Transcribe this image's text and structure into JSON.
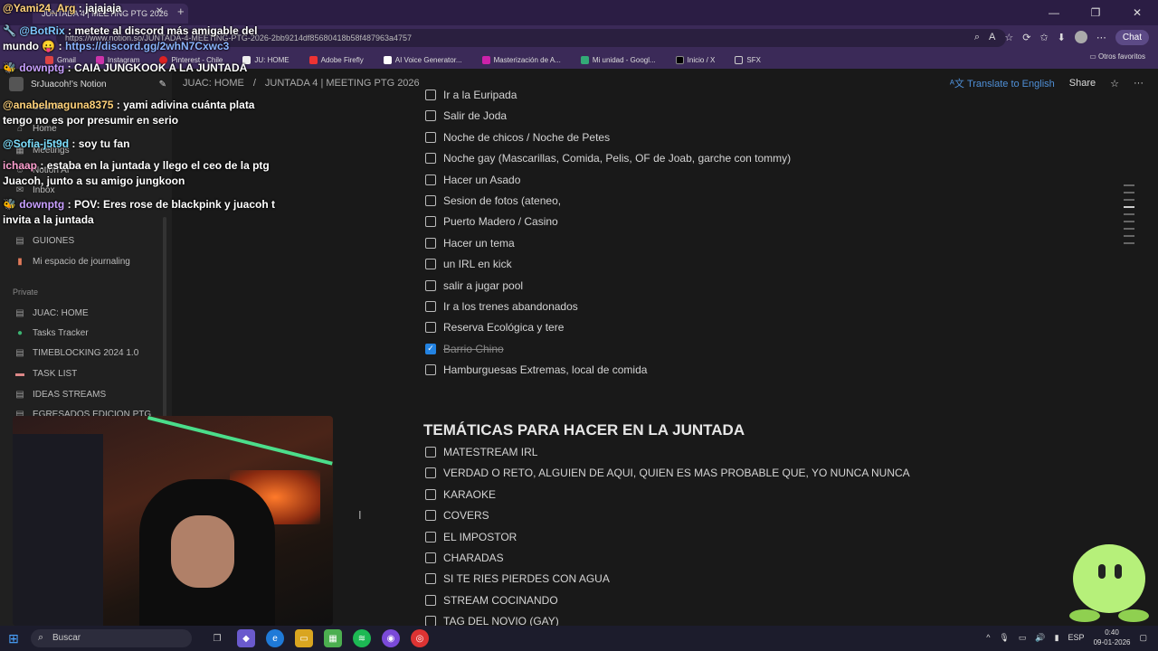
{
  "browser": {
    "tab_title": "JUNTADA 4 | MEETING PTG 2026",
    "url": "https://www.notion.so/JUNTADA-4-MEETING-PTG-2026-2bb9214df85680418b58f487963a4757",
    "chat_label": "Chat",
    "bookmarks": [
      "Gmail",
      "Instagram",
      "Pinterest - Chile",
      "JU: HOME",
      "Adobe Firefly",
      "AI Voice Generator...",
      "Masterización de A...",
      "Mi unidad - Googl...",
      "Inicio / X",
      "SFX"
    ],
    "other_bookmarks": "Otros favoritos"
  },
  "notion": {
    "workspace": "SrJuacoh!'s Notion",
    "breadcrumb": [
      "JUAC: HOME",
      "/",
      "JUNTADA 4 | MEETING PTG 2026"
    ],
    "translate_label": "Translate to English",
    "share_label": "Share",
    "more_label": "···"
  },
  "sidebar": {
    "top_items": [
      "Search",
      "Home",
      "Meetings",
      "Notion AI",
      "Inbox"
    ],
    "shared_items": [
      "GUIONES",
      "Mi espacio de journaling"
    ],
    "private_label": "Private",
    "private_items": [
      "JUAC: HOME",
      "Tasks Tracker",
      "TIMEBLOCKING 2024 1.0",
      "TASK LIST",
      "IDEAS STREAMS",
      "EGRESADOS EDICION PTG"
    ]
  },
  "todos_top": [
    {
      "text": "Ir a la Euripada",
      "checked": false
    },
    {
      "text": "Salir de Joda",
      "checked": false
    },
    {
      "text": "Noche de chicos / Noche de Petes",
      "checked": false
    },
    {
      "text": "Noche gay (Mascarillas, Comida, Pelis, OF de Joab, garche con tommy)",
      "checked": false
    },
    {
      "text": "Hacer un Asado",
      "checked": false
    },
    {
      "text": "Sesion de fotos (ateneo,",
      "checked": false
    },
    {
      "text": "Puerto Madero / Casino",
      "checked": false
    },
    {
      "text": "Hacer un tema",
      "checked": false
    },
    {
      "text": "un IRL en kick",
      "checked": false
    },
    {
      "text": "salir a jugar pool",
      "checked": false
    },
    {
      "text": "Ir a los trenes abandonados",
      "checked": false
    },
    {
      "text": "Reserva Ecológica y tere",
      "checked": false
    },
    {
      "text": "Barrio Chino",
      "checked": true
    },
    {
      "text": "Hamburguesas Extremas, local de comida",
      "checked": false
    }
  ],
  "section_heading": "TEMÁTICAS PARA HACER EN LA JUNTADA",
  "todos_bottom": [
    {
      "text": "MATESTREAM IRL",
      "checked": false
    },
    {
      "text": "VERDAD O RETO, ALGUIEN DE AQUI, QUIEN ES MAS PROBABLE QUE, YO NUNCA NUNCA",
      "checked": false
    },
    {
      "text": "KARAOKE",
      "checked": false
    },
    {
      "text": "COVERS",
      "checked": false
    },
    {
      "text": "EL IMPOSTOR",
      "checked": false
    },
    {
      "text": "CHARADAS",
      "checked": false
    },
    {
      "text": "SI TE RIES PIERDES CON AGUA",
      "checked": false
    },
    {
      "text": "STREAM COCINANDO",
      "checked": false
    },
    {
      "text": "TAG DEL NOVIO (GAY)",
      "checked": false
    }
  ],
  "chat": [
    {
      "user": "@Yami24_Arg",
      "text": ": jajajaja"
    },
    {
      "user": "@BotRix",
      "text": ": metete al discord más amigable del mundo 😛 :",
      "link": "https://discord.gg/2whN7Cxwc3"
    },
    {
      "user": "downptg",
      "text": ": CAIA JUNGKOOK A LA JUNTADA"
    },
    {
      "user": "@anabelmaguna8375",
      "text": ": yami adivina cuánta plata tengo no es por presumir en serio"
    },
    {
      "user": "@Sofia-j5t9d",
      "text": ": soy tu fan"
    },
    {
      "user": "ichaap",
      "text": ": estaba en la juntada y llego el ceo de la ptg Juacoh, junto a su amigo jungkoon"
    },
    {
      "user": "downptg",
      "text": ": POV: Eres rose de blackpink y juacoh t invita a la juntada"
    }
  ],
  "taskbar": {
    "search_placeholder": "Buscar",
    "lang": "ESP",
    "time": "0:40",
    "date": "09-01-2026"
  }
}
